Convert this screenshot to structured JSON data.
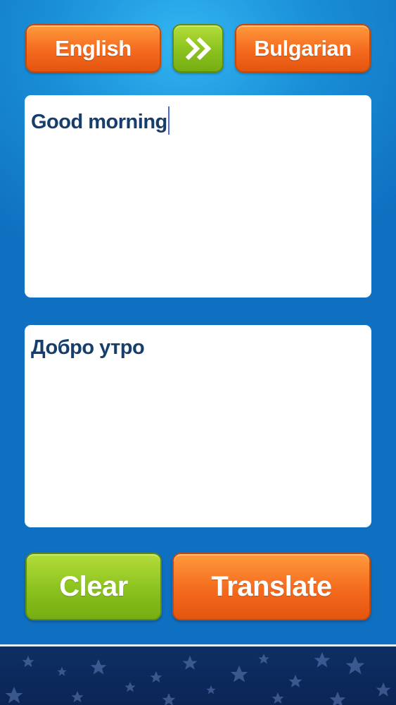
{
  "language_bar": {
    "source_language": "English",
    "swap_icon": "double-chevron-right-icon",
    "target_language": "Bulgarian"
  },
  "input": {
    "text": "Good morning"
  },
  "output": {
    "text": "Добро утро"
  },
  "actions": {
    "clear_label": "Clear",
    "translate_label": "Translate"
  },
  "footer": {
    "decoration_icon": "stars-icon"
  },
  "colors": {
    "background_blue": "#1a8fd8",
    "button_orange": "#f46a1e",
    "button_green": "#8bc21e",
    "text_navy": "#163d6b",
    "footer_navy": "#0e2e63"
  }
}
